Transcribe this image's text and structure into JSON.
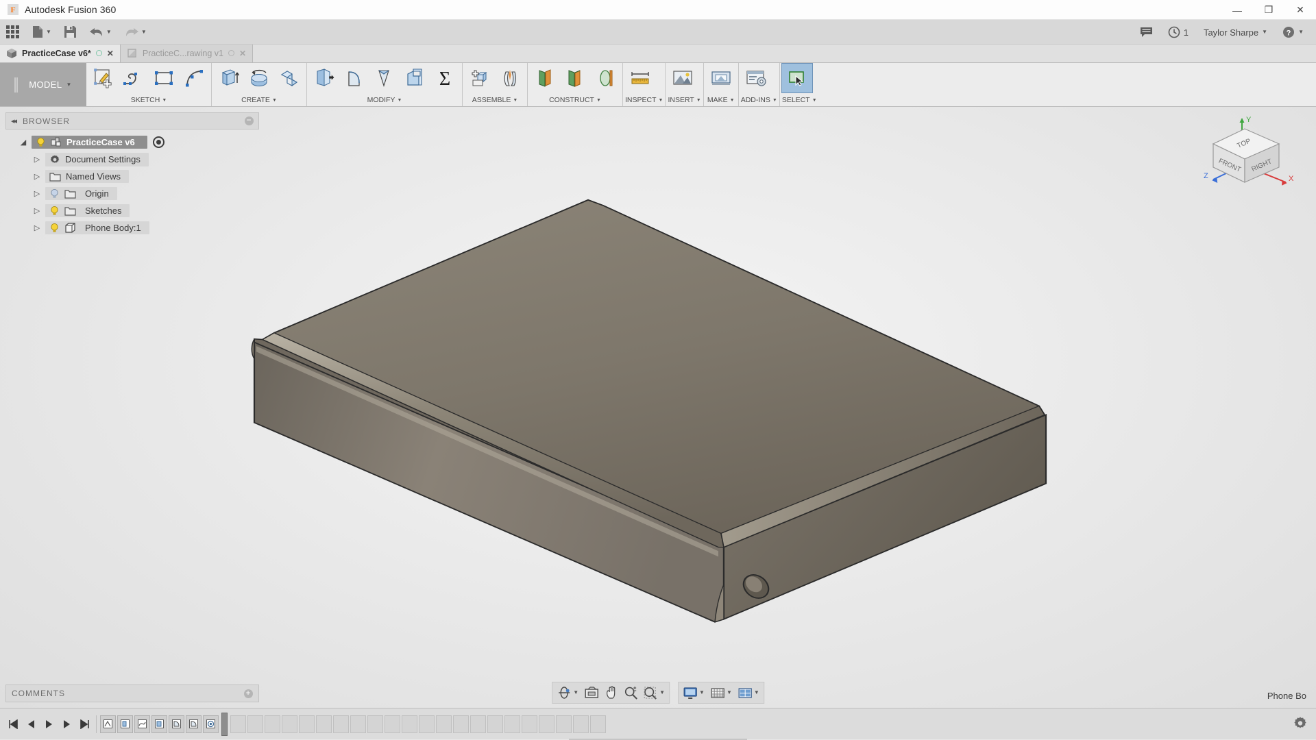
{
  "window": {
    "app_title": "Autodesk Fusion 360",
    "logo_letter": "F",
    "minimize": "—",
    "maximize": "❐",
    "close": "✕"
  },
  "quick_access": {
    "apps_grid": "app-grid",
    "new_file": "new-file",
    "save": "save",
    "undo": "undo",
    "redo": "redo",
    "notifications_icon": "comment-icon",
    "job_status_icon": "clock-icon",
    "job_status_count": "1",
    "user_name": "Taylor Sharpe",
    "help_icon": "help-icon"
  },
  "tabs": [
    {
      "label": "PracticeCase v6*",
      "icon": "model-cube-icon",
      "active": true,
      "close": "✕"
    },
    {
      "label": "PracticeC...rawing v1",
      "icon": "drawing-icon",
      "active": false,
      "close": "✕"
    }
  ],
  "ribbon": {
    "workspace": "MODEL",
    "groups": [
      {
        "label": "SKETCH",
        "icons": [
          "create-sketch-icon",
          "line-icon",
          "rectangle-icon",
          "arc-icon"
        ]
      },
      {
        "label": "CREATE",
        "icons": [
          "extrude-icon",
          "revolve-icon",
          "sweep-icon"
        ]
      },
      {
        "label": "MODIFY",
        "icons": [
          "press-pull-icon",
          "fillet-icon",
          "chamfer-icon",
          "shell-icon",
          "combine-icon"
        ]
      },
      {
        "label": "ASSEMBLE",
        "icons": [
          "new-component-icon",
          "joint-icon"
        ]
      },
      {
        "label": "CONSTRUCT",
        "icons": [
          "offset-plane-icon",
          "plane-at-angle-icon",
          "axis-icon"
        ]
      },
      {
        "label": "INSPECT",
        "icons": [
          "measure-icon"
        ]
      },
      {
        "label": "INSERT",
        "icons": [
          "insert-mesh-icon"
        ]
      },
      {
        "label": "MAKE",
        "icons": [
          "3d-print-icon"
        ]
      },
      {
        "label": "ADD-INS",
        "icons": [
          "scripts-addins-icon"
        ]
      },
      {
        "label": "SELECT",
        "icons": [
          "select-icon"
        ],
        "selected": true
      }
    ]
  },
  "browser": {
    "title": "BROWSER",
    "collapse_icon": "collapse-left-icon",
    "pin_icon": "minus-circle-icon",
    "tree": [
      {
        "label": "PracticeCase v6",
        "level": 0,
        "twist": "◢",
        "bulb": "on",
        "icon": "component-icon",
        "root": true,
        "visdot": true
      },
      {
        "label": "Document Settings",
        "level": 1,
        "twist": "▷",
        "bulb": "none",
        "icon": "gear-icon"
      },
      {
        "label": "Named Views",
        "level": 1,
        "twist": "▷",
        "bulb": "none",
        "icon": "folder-icon"
      },
      {
        "label": "Origin",
        "level": 1,
        "twist": "▷",
        "bulb": "off",
        "icon": "folder-icon"
      },
      {
        "label": "Sketches",
        "level": 1,
        "twist": "▷",
        "bulb": "on",
        "icon": "folder-icon"
      },
      {
        "label": "Phone Body:1",
        "level": 1,
        "twist": "▷",
        "bulb": "on",
        "icon": "body-icon"
      }
    ]
  },
  "comments": {
    "title": "COMMENTS",
    "pin_icon": "plus-circle-icon"
  },
  "navigation_bar": {
    "group_a": [
      "orbit-icon",
      "look-at-icon",
      "pan-icon",
      "zoom-icon",
      "zoom-window-icon"
    ],
    "group_b": [
      "display-settings-icon",
      "grid-snap-icon",
      "viewports-icon"
    ]
  },
  "status_bar": {
    "right_text": "Phone Bo"
  },
  "view_cube": {
    "top": "TOP",
    "front": "FRONT",
    "right": "RIGHT",
    "axis_x": "X",
    "axis_y": "Y",
    "axis_z": "Z",
    "x_color": "#d83b3b",
    "y_color": "#3fa63f",
    "z_color": "#3b6fd8"
  },
  "timeline": {
    "playback": [
      "jump-start-icon",
      "step-back-icon",
      "play-icon",
      "step-forward-icon",
      "jump-end-icon"
    ],
    "features": [
      "sketch-icon",
      "extrude-icon",
      "sketch-icon",
      "extrude-icon",
      "fillet-icon",
      "fillet-icon",
      "shell-icon"
    ],
    "marker_name": "timeline-marker",
    "placeholder_count": 22,
    "settings_icon": "gear-icon"
  },
  "model": {
    "name": "Phone Body",
    "body_top_color": "#7b7468",
    "body_front_color": "#8a8278",
    "body_side_color": "#6e675d",
    "outline_color": "#2b2b2b"
  }
}
